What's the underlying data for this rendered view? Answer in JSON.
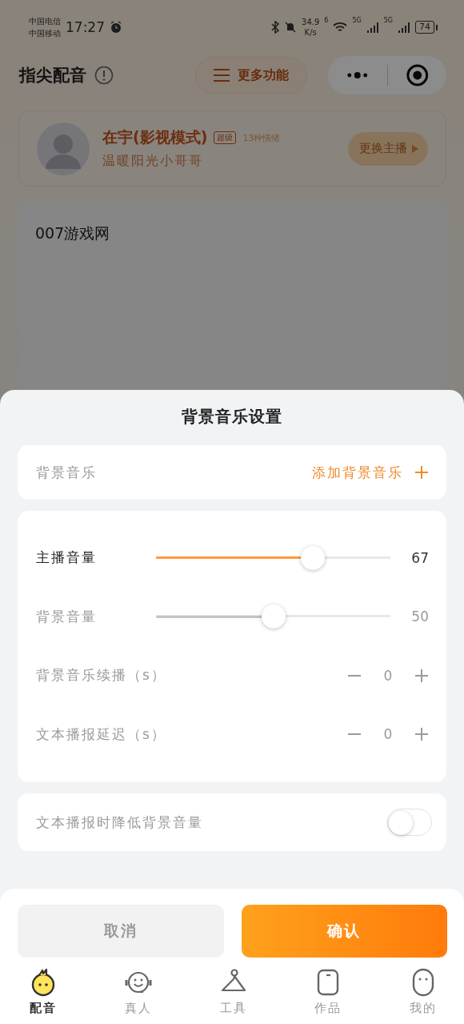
{
  "status_bar": {
    "carriers": [
      "中国电信",
      "中国移动"
    ],
    "time": "17:27",
    "net_speed": "34.9",
    "net_unit": "K/s",
    "wifi_label": "6",
    "signal_labels": [
      "5G",
      "5G"
    ],
    "battery": "74"
  },
  "header": {
    "title": "指尖配音",
    "more_button": "更多功能"
  },
  "host": {
    "name": "在宇(影视模式)",
    "badge": "超级",
    "emotions": "13种情绪",
    "description": "温暖阳光小哥哥",
    "change_button": "更换主播"
  },
  "editor": {
    "value": "007游戏网"
  },
  "sheet": {
    "title": "背景音乐设置",
    "music": {
      "label": "背景音乐",
      "action": "添加背景音乐"
    },
    "controls": [
      {
        "kind": "slider",
        "label": "主播音量",
        "disabled": false,
        "level": 0.67,
        "reading": "67"
      },
      {
        "kind": "slider",
        "label": "背景音量",
        "disabled": true,
        "level": 0.5,
        "reading": "50"
      },
      {
        "kind": "stepper",
        "label": "背景音乐续播（s）",
        "disabled": true,
        "value": "0"
      },
      {
        "kind": "stepper",
        "label": "文本播报延迟（s）",
        "disabled": true,
        "value": "0"
      }
    ],
    "toggle": {
      "label": "文本播报时降低背景音量",
      "on": false
    },
    "buttons": [
      {
        "kind": "secondary",
        "label": "取消"
      },
      {
        "kind": "primary",
        "label": "确认"
      }
    ]
  },
  "tab_bar": [
    {
      "label": "配音",
      "selected": true
    },
    {
      "label": "真人",
      "selected": false
    },
    {
      "label": "工具",
      "selected": false
    },
    {
      "label": "作品",
      "selected": false
    },
    {
      "label": "我的",
      "selected": false
    }
  ]
}
